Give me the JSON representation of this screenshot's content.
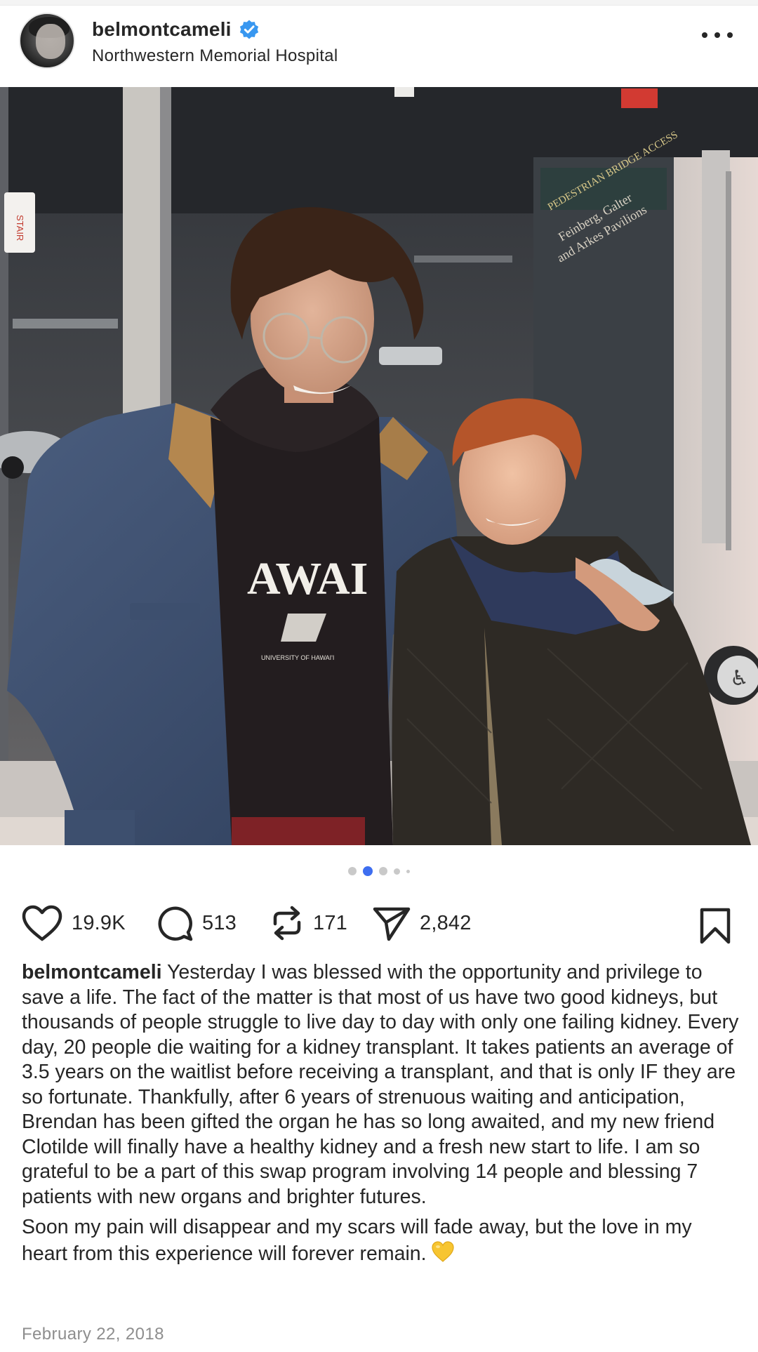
{
  "post": {
    "username": "belmontcameli",
    "location": "Northwestern Memorial Hospital",
    "verified": true,
    "photo_text": {
      "shirt": "AWAI",
      "shirt_small": "UNIVERSITY OF HAWAI'I",
      "door_sign_1": "PEDESTRIAN BRIDGE ACCESS",
      "door_sign_2": "Feinberg, Galter",
      "door_sign_3": "and Arkes Pavilions",
      "left_sign": "STAIR"
    },
    "carousel": {
      "count": 5,
      "active_index": 1
    },
    "stats": {
      "likes": "19.9K",
      "comments": "513",
      "reposts": "171",
      "shares": "2,842"
    },
    "caption": {
      "username": "belmontcameli",
      "paragraph1": "Yesterday I was blessed with the opportunity and privilege to save a life. The fact of the matter is that most of us have two good kidneys, but thousands of people struggle to live day to day with only one failing kidney. Every day, 20 people die waiting for a kidney transplant. It takes patients an average of 3.5 years on the waitlist before receiving a transplant, and that is only IF they are so fortunate. Thankfully, after 6 years of strenuous waiting and anticipation, Brendan has been gifted the organ he has so long awaited, and my new friend Clotilde will finally have a healthy kidney and a fresh new start to life. I am so grateful to be a part of this swap program involving 14 people and blessing 7 patients with new organs and brighter futures.",
      "paragraph2": "Soon my pain will disappear and my scars will fade away, but the love in my heart from this experience will forever remain.",
      "emoji": "yellow-heart-icon"
    },
    "date": "February 22, 2018"
  },
  "colors": {
    "verified_blue": "#3897f0",
    "dot_active": "#3e6ef0",
    "emoji_yellow": "#f7c531",
    "text": "#262626",
    "muted": "#8e8e8e"
  }
}
